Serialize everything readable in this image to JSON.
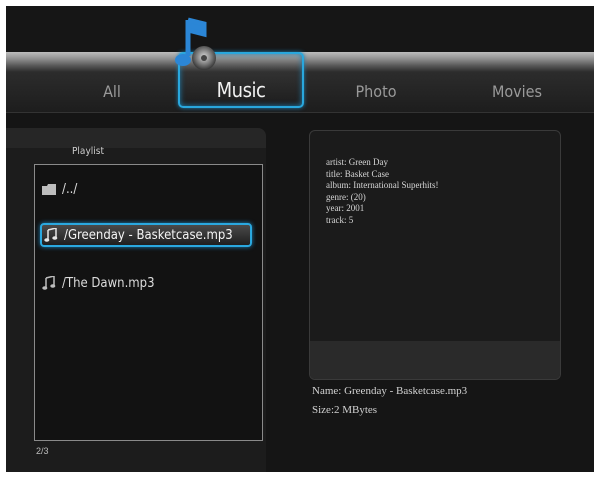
{
  "tabs": [
    {
      "label": "All"
    },
    {
      "label": "Music"
    },
    {
      "label": "Photo"
    },
    {
      "label": "Movies"
    }
  ],
  "active_tab": "Music",
  "playlist": {
    "title": "Playlist",
    "items": [
      {
        "label": "/../",
        "icon": "folder-icon"
      },
      {
        "label": "/Greenday - Basketcase.mp3",
        "icon": "music-note-icon",
        "selected": true
      },
      {
        "label": "/The Dawn.mp3",
        "icon": "music-note-icon"
      }
    ],
    "counter": "2/3"
  },
  "track_info": {
    "artist": "artist: Green Day",
    "title": "title: Basket Case",
    "album": "album: International Superhits!",
    "genre": "genre: (20)",
    "year": "year: 2001",
    "track": "track: 5"
  },
  "file_meta": {
    "name": "Name: Greenday - Basketcase.mp3",
    "size": "Size:2 MBytes"
  },
  "colors": {
    "background": "#151515",
    "highlight": "#29a7dd",
    "text": "#dcdcdc"
  }
}
